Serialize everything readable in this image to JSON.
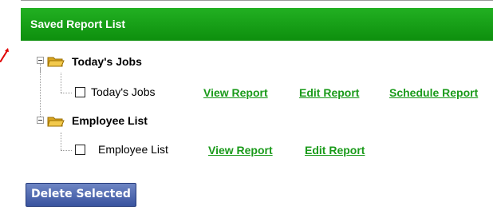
{
  "panel": {
    "title": "Saved Report List"
  },
  "groups": [
    {
      "label": "Today's Jobs",
      "item": {
        "label": "Today's Jobs",
        "links": [
          "View Report",
          "Edit Report",
          "Schedule Report"
        ]
      }
    },
    {
      "label": "Employee List",
      "item": {
        "label": "Employee List",
        "links": [
          "View Report",
          "Edit Report"
        ]
      }
    }
  ],
  "actions": {
    "delete_label": "Delete Selected"
  },
  "colors": {
    "header_green": "#0d8f0d",
    "link_green": "#1a9a1a",
    "button_blue": "#39539f",
    "folder_yellow": "#f2c94c"
  },
  "icons": [
    "tree-collapse-icon",
    "folder-open-icon",
    "checkbox-icon"
  ]
}
